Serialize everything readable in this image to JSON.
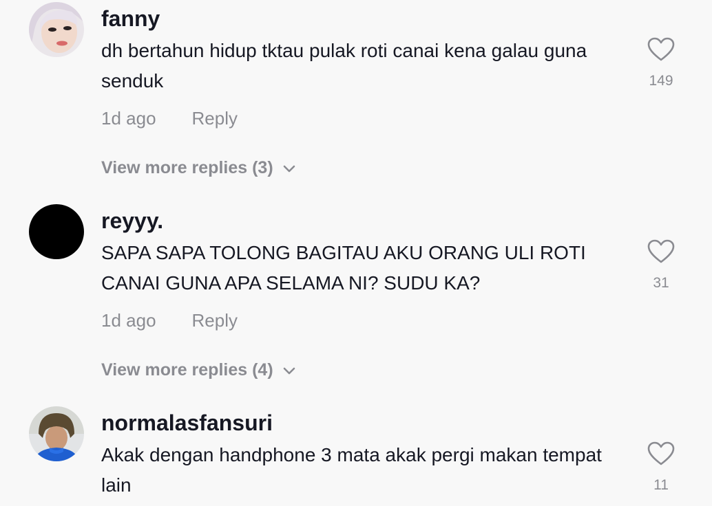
{
  "comments": [
    {
      "username": "fanny",
      "text": "dh bertahun hidup tktau pulak roti canai kena galau guna senduk",
      "time": "1d ago",
      "reply_label": "Reply",
      "likes": "149",
      "view_more": "View more replies (3)"
    },
    {
      "username": "reyyy.",
      "text": "SAPA SAPA TOLONG BAGITAU AKU ORANG ULI ROTI CANAI GUNA APA SELAMA NI? SUDU KA?",
      "time": "1d ago",
      "reply_label": "Reply",
      "likes": "31",
      "view_more": "View more replies (4)"
    },
    {
      "username": "normalasfansuri",
      "text": "Akak dengan handphone 3 mata akak pergi makan tempat lain",
      "likes": "11"
    }
  ],
  "icons": {
    "like": "heart-outline-icon",
    "expand": "chevron-down-icon"
  },
  "colors": {
    "background": "#f8f8f8",
    "primary_text": "#161823",
    "secondary_text": "#8a8b91"
  }
}
